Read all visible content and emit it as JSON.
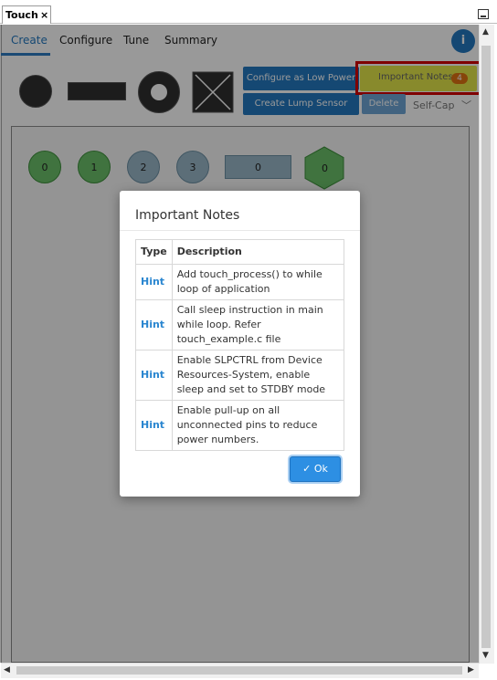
{
  "view_tab": {
    "label": "Touch",
    "close": "×"
  },
  "nav": {
    "tabs": [
      "Create",
      "Configure",
      "Tune",
      "Summary"
    ],
    "active": "Create"
  },
  "info_icon": "i",
  "toolbar": {
    "configure_low_power": "Configure as Low Power",
    "create_lump_sensor": "Create Lump Sensor",
    "important_notes": "Important Notes",
    "notes_count": "4",
    "delete": "Delete",
    "sensing_mode": "Self-Cap",
    "dropdown_arrow": "﹀"
  },
  "sensors": {
    "buttons": [
      "0",
      "1",
      "2",
      "3"
    ],
    "slider": "0",
    "surface": "0"
  },
  "dialog": {
    "title": "Important Notes",
    "headers": {
      "type": "Type",
      "description": "Description"
    },
    "rows": [
      {
        "type": "Hint",
        "description": "Add touch_process() to while loop of application"
      },
      {
        "type": "Hint",
        "description": "Call sleep instruction in main while loop. Refer touch_example.c file"
      },
      {
        "type": "Hint",
        "description": "Enable SLPCTRL from Device Resources-System, enable sleep and set to STDBY mode"
      },
      {
        "type": "Hint",
        "description": "Enable pull-up on all unconnected pins to reduce power numbers."
      }
    ],
    "ok_icon": "✓",
    "ok_label": "Ok"
  },
  "scroll": {
    "up": "▲",
    "down": "▼",
    "left": "◀",
    "right": "▶"
  },
  "colors": {
    "accent": "#2479c0",
    "notes_button": "#e3e74a",
    "highlight": "#d40000",
    "badge": "#e07412",
    "sensor_green": "#6cc06a",
    "sensor_blue": "#9ab8c9"
  }
}
